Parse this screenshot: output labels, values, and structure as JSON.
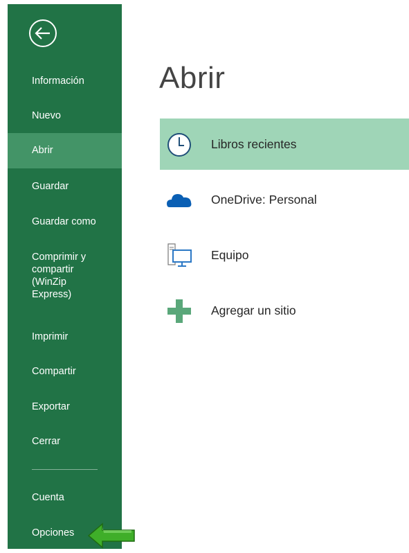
{
  "colors": {
    "sidebar_bg": "#217346",
    "sidebar_selected_bg": "#439467",
    "location_selected_bg": "#9fd5b7",
    "arrow_green": "#3fae29"
  },
  "sidebar": {
    "back_icon": "back-arrow-circle-icon",
    "items": [
      {
        "label": "Información",
        "selected": false
      },
      {
        "label": "Nuevo",
        "selected": false
      },
      {
        "label": "Abrir",
        "selected": true
      },
      {
        "label": "Guardar",
        "selected": false
      },
      {
        "label": "Guardar como",
        "selected": false
      },
      {
        "label": "Comprimir y compartir (WinZip Express)",
        "selected": false
      },
      {
        "label": "Imprimir",
        "selected": false
      },
      {
        "label": "Compartir",
        "selected": false
      },
      {
        "label": "Exportar",
        "selected": false
      },
      {
        "label": "Cerrar",
        "selected": false
      },
      {
        "label": "Cuenta",
        "selected": false
      },
      {
        "label": "Opciones",
        "selected": false
      }
    ]
  },
  "main": {
    "title": "Abrir",
    "locations": [
      {
        "label": "Libros recientes",
        "icon": "clock-icon",
        "selected": true
      },
      {
        "label": "OneDrive: Personal",
        "icon": "cloud-icon",
        "selected": false
      },
      {
        "label": "Equipo",
        "icon": "computer-icon",
        "selected": false
      },
      {
        "label": "Agregar un sitio",
        "icon": "plus-icon",
        "selected": false
      }
    ]
  },
  "annotation": {
    "icon": "green-arrow-icon"
  }
}
